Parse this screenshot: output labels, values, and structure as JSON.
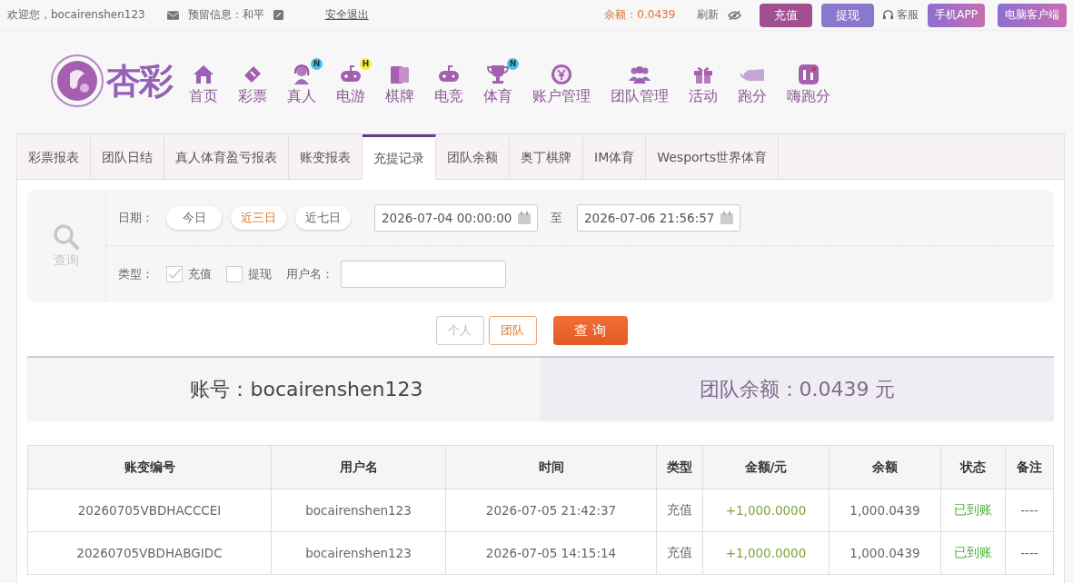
{
  "topbar": {
    "welcome": "欢迎您，bocairenshen123",
    "reserved": "预留信息：和平",
    "logout": "安全退出",
    "balance": "余额：0.0439",
    "refresh": "刷新",
    "deposit": "充值",
    "withdraw": "提现",
    "service": "客服",
    "app": "手机APP",
    "pc": "电脑客户端"
  },
  "logo": {
    "text": "杏彩"
  },
  "nav": [
    {
      "label": "首页"
    },
    {
      "label": "彩票"
    },
    {
      "label": "真人",
      "badge": "N",
      "color": "#3cc6f0"
    },
    {
      "label": "电游",
      "badge": "H",
      "color": "#f5ee3a"
    },
    {
      "label": "棋牌"
    },
    {
      "label": "电竞"
    },
    {
      "label": "体育",
      "badge": "N",
      "color": "#3cc6f0"
    },
    {
      "label": "账户管理"
    },
    {
      "label": "团队管理"
    },
    {
      "label": "活动"
    },
    {
      "label": "跑分"
    },
    {
      "label": "嗨跑分"
    }
  ],
  "tabs": [
    {
      "label": "彩票报表",
      "selected": false
    },
    {
      "label": "团队日结",
      "selected": false
    },
    {
      "label": "真人体育盈亏报表",
      "selected": false
    },
    {
      "label": "账变报表",
      "selected": false
    },
    {
      "label": "充提记录",
      "selected": true
    },
    {
      "label": "团队余额",
      "selected": false
    },
    {
      "label": "奥丁棋牌",
      "selected": false
    },
    {
      "label": "IM体育",
      "selected": false
    },
    {
      "label": "Wesports世界体育",
      "selected": false
    }
  ],
  "filter": {
    "side_label": "查询",
    "date_label": "日期：",
    "quick_ranges": [
      {
        "label": "今日",
        "selected": false
      },
      {
        "label": "近三日",
        "selected": true
      },
      {
        "label": "近七日",
        "selected": false
      }
    ],
    "start": "2026-07-04 00:00:00",
    "to": "至",
    "end": "2026-07-06 21:56:57",
    "type_label": "类型：",
    "types": [
      {
        "label": "充值",
        "checked": true
      },
      {
        "label": "提现",
        "checked": false
      }
    ],
    "username_label": "用户名："
  },
  "scopes": [
    {
      "label": "个人",
      "selected": false
    },
    {
      "label": "团队",
      "selected": true
    }
  ],
  "query_button": "查 询",
  "summary": {
    "account": "账号：bocairenshen123",
    "team_balance": "团队余额：0.0439 元"
  },
  "table": {
    "columns": [
      "账变编号",
      "用户名",
      "时间",
      "类型",
      "金额/元",
      "余额",
      "状态",
      "备注"
    ],
    "rows": [
      [
        "20260705VBDHACCCEI",
        "bocairenshen123",
        "2026-07-05 21:42:37",
        "充值",
        "+1,000.0000",
        "1,000.0439",
        "已到账",
        "----"
      ],
      [
        "20260705VBDHABGIDC",
        "bocairenshen123",
        "2026-07-05 14:15:14",
        "充值",
        "+1,000.0000",
        "1,000.0439",
        "已到账",
        "----"
      ]
    ]
  }
}
